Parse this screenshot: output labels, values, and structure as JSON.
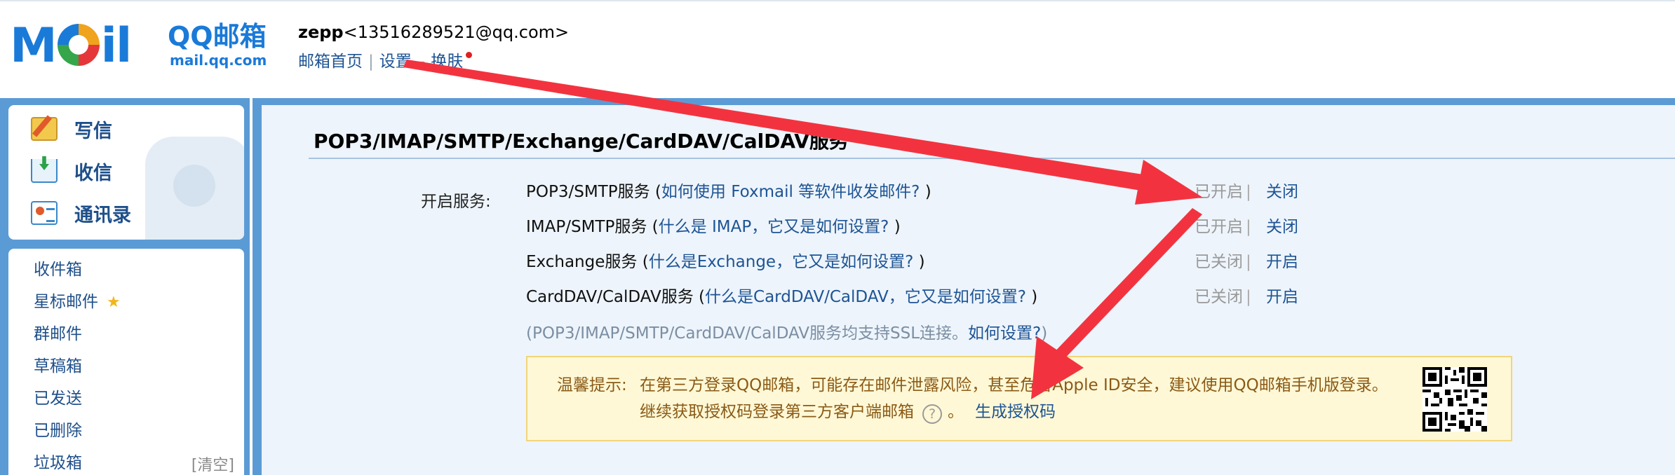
{
  "header": {
    "logo_text_mail": "M",
    "logo_text_il": "il",
    "logo_qq": "QQ邮箱",
    "logo_domain": "mail.qq.com",
    "user_name": "zepp",
    "user_email": "<13516289521@qq.com>",
    "links": [
      "邮箱首页",
      "设置",
      "换肤"
    ],
    "link_separators": [
      "|",
      "–"
    ]
  },
  "sidebar": {
    "quick": [
      {
        "label": "写信",
        "icon": "compose-icon"
      },
      {
        "label": "收信",
        "icon": "inbox-download-icon"
      },
      {
        "label": "通讯录",
        "icon": "contacts-icon"
      }
    ],
    "folders": [
      {
        "label": "收件箱"
      },
      {
        "label": "星标邮件",
        "icon": "star-icon"
      },
      {
        "label": "群邮件"
      },
      {
        "label": "草稿箱"
      },
      {
        "label": "已发送"
      },
      {
        "label": "已删除"
      },
      {
        "label": "垃圾箱",
        "action": "[清空]"
      }
    ]
  },
  "main": {
    "title": "POP3/IMAP/SMTP/Exchange/CardDAV/CalDAV服务",
    "services_label": "开启服务:",
    "services": [
      {
        "name": "POP3/SMTP服务",
        "open_paren": "(",
        "help": "如何使用 Foxmail 等软件收发邮件?",
        "close_paren": ")",
        "state": "已开启",
        "action": "关闭"
      },
      {
        "name": "IMAP/SMTP服务",
        "open_paren": "(",
        "help": "什么是 IMAP，它又是如何设置?",
        "close_paren": ")",
        "state": "已开启",
        "action": "关闭"
      },
      {
        "name": "Exchange服务",
        "open_paren": "(",
        "help": "什么是Exchange，它又是如何设置?",
        "close_paren": ")",
        "state": "已关闭",
        "action": "开启"
      },
      {
        "name": "CardDAV/CalDAV服务",
        "open_paren": "(",
        "help": "什么是CardDAV/CalDAV，它又是如何设置?",
        "close_paren": ")",
        "state": "已关闭",
        "action": "开启"
      }
    ],
    "state_separator": "|",
    "ssl_note": "(POP3/IMAP/SMTP/CardDAV/CalDAV服务均支持SSL连接。",
    "ssl_help": "如何设置?",
    "ssl_close": ")",
    "tip": {
      "label": "温馨提示:",
      "line1": "在第三方登录QQ邮箱，可能存在邮件泄露风险，甚至危害Apple ID安全，建议使用QQ邮箱手机版登录。",
      "line2": "继续获取授权码登录第三方客户端邮箱",
      "help_glyph": "?",
      "line2_end": "。",
      "generate": "生成授权码"
    }
  },
  "annotation_color": "#f2333f"
}
